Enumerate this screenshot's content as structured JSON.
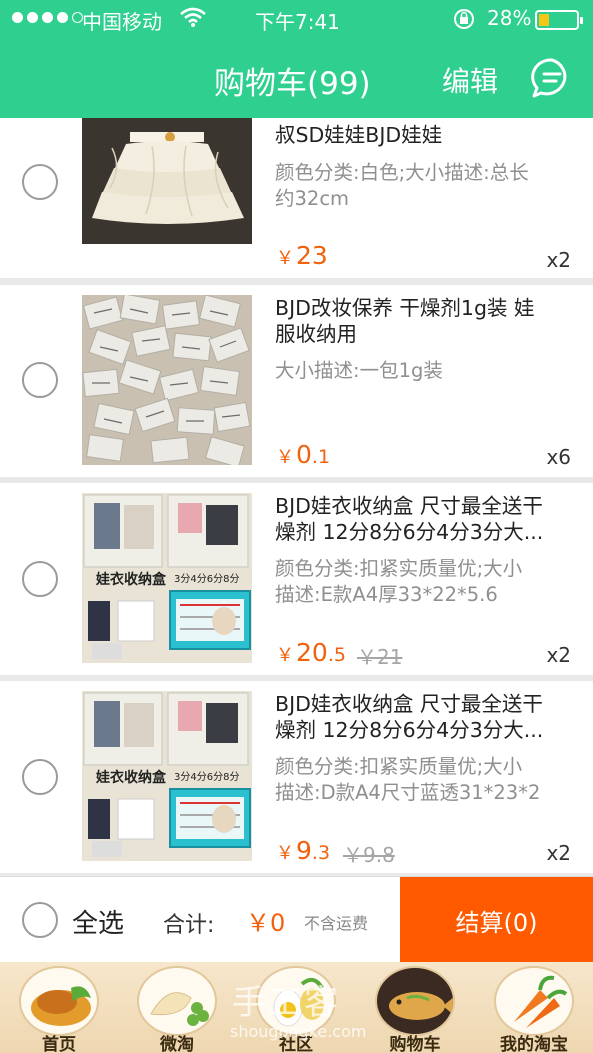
{
  "status_bar": {
    "carrier": "中国移动",
    "time": "下午7:41",
    "battery_percent": "28%",
    "battery_level": 0.28,
    "signal_bars": 4
  },
  "header": {
    "title": "购物车(99)",
    "edit_label": "编辑",
    "message_icon": "chat-bubble-icon",
    "background": "#2ecf8f"
  },
  "items": [
    {
      "name_lines": [
        "叔SD娃娃BJD娃娃"
      ],
      "attr_lines": [
        "颜色分类:白色;大小描述:总长",
        "约32cm"
      ],
      "price_int": "23",
      "price_dec": "",
      "old_price": "",
      "quantity": "x2",
      "image": "white-ruffle-skirt"
    },
    {
      "name_lines": [
        "BJD改妆保养 干燥剂1g装 娃",
        "服收纳用"
      ],
      "attr_lines": [
        "大小描述:一包1g装"
      ],
      "price_int": "0",
      "price_dec": ".1",
      "old_price": "",
      "quantity": "x6",
      "image": "desiccant-packets"
    },
    {
      "name_lines": [
        "BJD娃衣收纳盒 尺寸最全送干",
        "燥剂 12分8分6分4分3分大..."
      ],
      "attr_lines": [
        "颜色分类:扣紧实质量优;大小",
        "描述:E款A4厚33*22*5.6"
      ],
      "price_int": "20",
      "price_dec": ".5",
      "old_price": "￥21",
      "quantity": "x2",
      "image": "storage-box",
      "image_caption": "娃衣收纳盒",
      "image_sizes": "3分4分6分8分"
    },
    {
      "name_lines": [
        "BJD娃衣收纳盒 尺寸最全送干",
        "燥剂 12分8分6分4分3分大..."
      ],
      "attr_lines": [
        "颜色分类:扣紧实质量优;大小",
        "描述:D款A4尺寸蓝透31*23*2"
      ],
      "price_int": "9",
      "price_dec": ".3",
      "old_price": "￥9.8",
      "quantity": "x2",
      "image": "storage-box",
      "image_caption": "娃衣收纳盒",
      "image_sizes": "3分4分6分8分"
    }
  ],
  "currency": "￥",
  "checkout": {
    "select_all": "全选",
    "total_label": "合计:",
    "total_value": "￥0",
    "shipping_note": "不含运费",
    "pay_label": "结算(0)",
    "pay_color": "#ff5a00"
  },
  "tabs": [
    {
      "label": "首页",
      "icon": "home-dish-icon"
    },
    {
      "label": "微淘",
      "icon": "dumpling-icon"
    },
    {
      "label": "社区",
      "icon": "community-egg-icon"
    },
    {
      "label": "购物车",
      "icon": "cart-fish-icon"
    },
    {
      "label": "我的淘宝",
      "icon": "carrot-icon"
    }
  ],
  "watermark": {
    "text": "手工客",
    "url_text": "shougongke.com"
  }
}
